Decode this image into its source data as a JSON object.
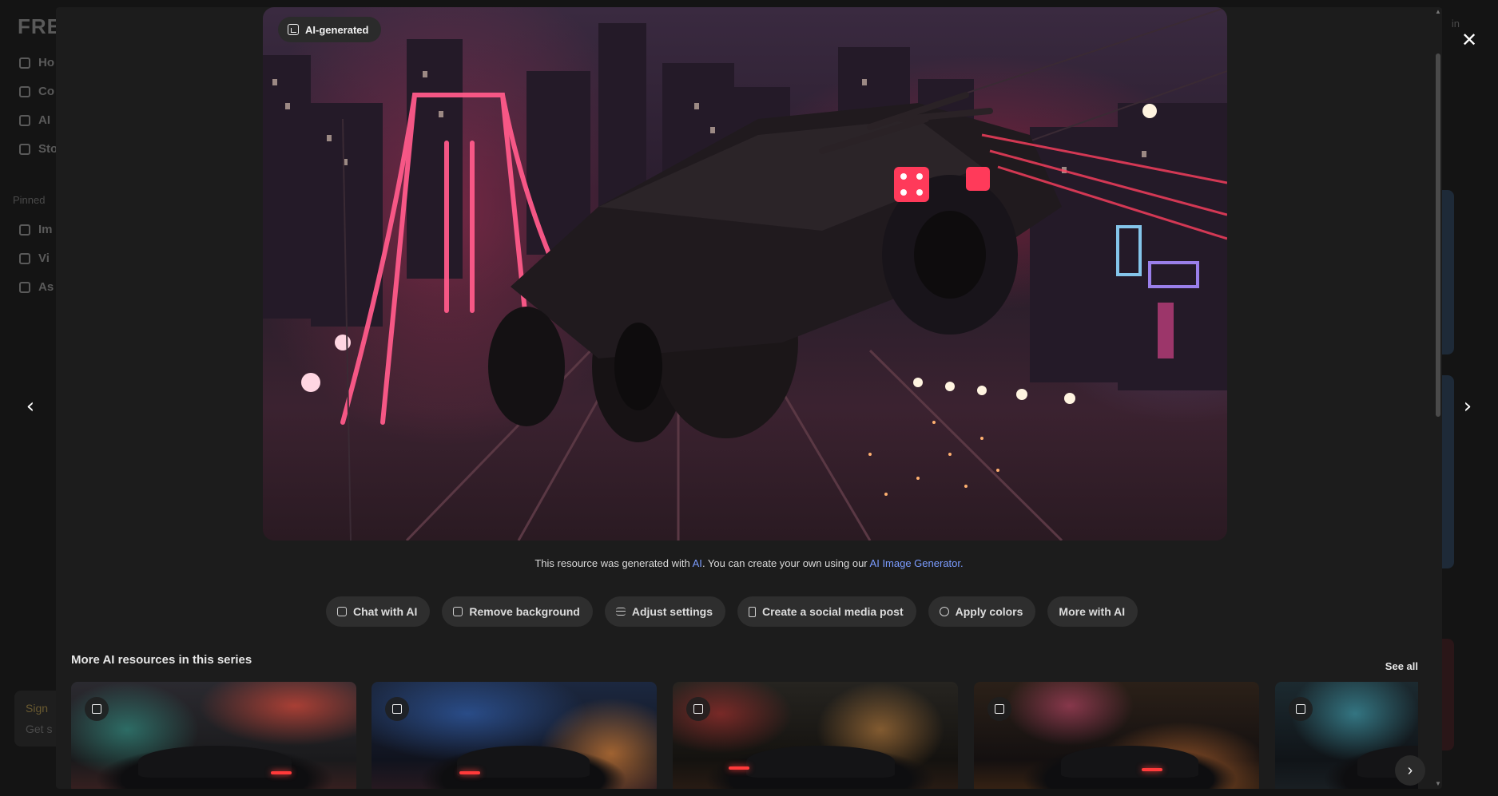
{
  "background_page": {
    "logo": "FRE",
    "nav": [
      "Ho",
      "Co",
      "AI",
      "Sto"
    ],
    "pinned_label": "Pinned",
    "pinned_items": [
      "Im",
      "Vi",
      "As"
    ],
    "sign_in": "in",
    "promo": {
      "line1": "Sign",
      "line2": "Get s"
    }
  },
  "modal": {
    "ai_badge": "AI-generated",
    "caption": {
      "prefix": "This resource was generated with",
      "ai_link": "AI",
      "middle": ". You can create your own using our",
      "generator_link": "AI Image Generator."
    },
    "actions": [
      {
        "label": "Chat with AI",
        "icon": "chat-icon"
      },
      {
        "label": "Remove background",
        "icon": "remove-background-icon"
      },
      {
        "label": "Adjust settings",
        "icon": "sliders-icon"
      },
      {
        "label": "Create a social media post",
        "icon": "phone-icon"
      },
      {
        "label": "Apply colors",
        "icon": "palette-icon"
      },
      {
        "label": "More with AI",
        "icon": ""
      }
    ],
    "series_title": "More AI resources in this series",
    "see_all": "See all",
    "close_glyph": "✕",
    "prev_glyph": "‹",
    "next_glyph": "›"
  },
  "colors": {
    "modal_bg": "#1c1c1c",
    "button_bg": "#2e2e2e",
    "link": "#7b9cff",
    "accent_neon": "#ff3a6a"
  }
}
